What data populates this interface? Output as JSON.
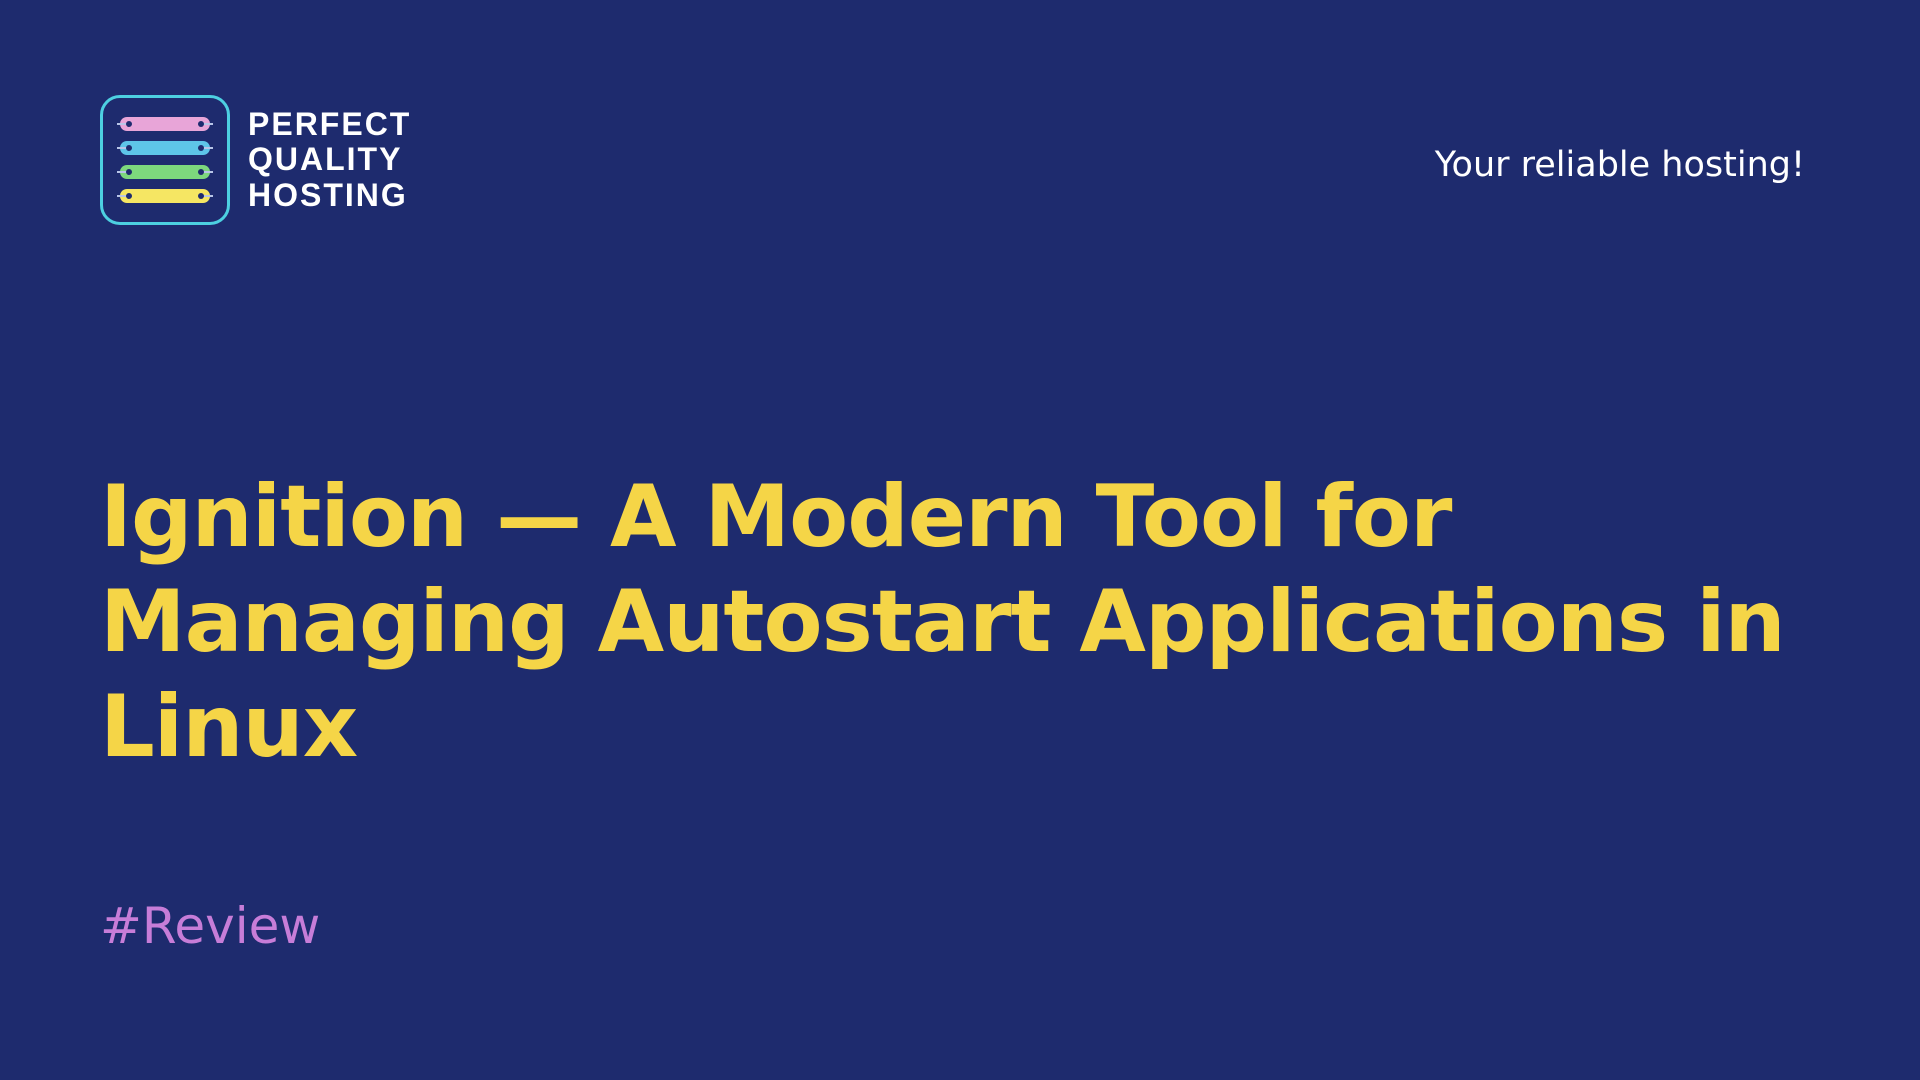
{
  "logo": {
    "line1": "PERFECT",
    "line2": "QUALITY",
    "line3": "HOSTING"
  },
  "tagline": "Your reliable hosting!",
  "title": "Ignition — A Modern Tool for Managing Autostart Applications in Linux",
  "hashtag": "#Review"
}
